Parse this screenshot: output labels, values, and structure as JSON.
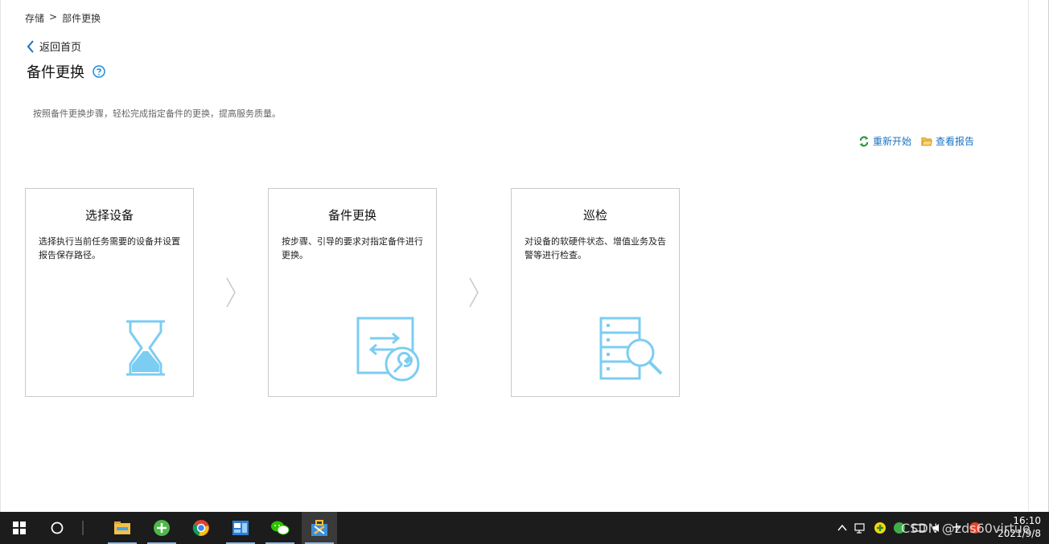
{
  "breadcrumb": {
    "root": "存储",
    "sep": ">",
    "current": "部件更换"
  },
  "back_label": "返回首页",
  "page_title": "备件更换",
  "description": "按照备件更换步骤，轻松完成指定备件的更换，提高服务质量。",
  "actions": {
    "restart": "重新开始",
    "view_report": "查看报告"
  },
  "steps": [
    {
      "title": "选择设备",
      "desc": "选择执行当前任务需要的设备并设置报告保存路径。",
      "icon": "hourglass-icon"
    },
    {
      "title": "备件更换",
      "desc": "按步骤、引导的要求对指定备件进行更换。",
      "icon": "replace-wrench-icon"
    },
    {
      "title": "巡检",
      "desc": "对设备的软硬件状态、增值业务及告警等进行检查。",
      "icon": "server-search-icon"
    }
  ],
  "colors": {
    "accent": "#1a73c0",
    "icon": "#7ccdf2",
    "taskbar": "#1c1c1c"
  },
  "taskbar": {
    "time": "16:10",
    "date": "2021/9/8",
    "watermark": "CSDN @zds60virtue"
  }
}
